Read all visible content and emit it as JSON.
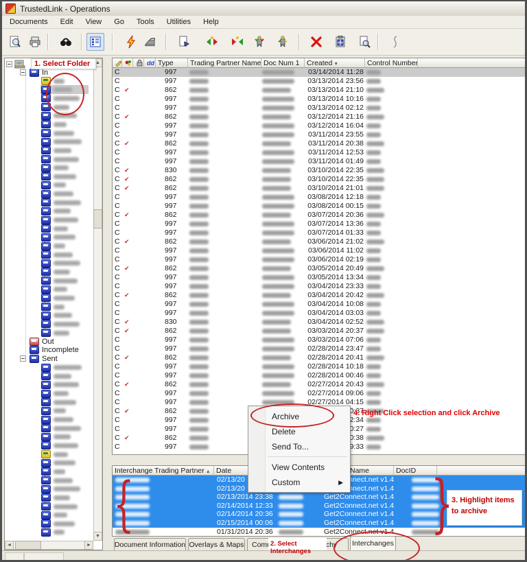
{
  "window": {
    "title": "TrustedLink - Operations"
  },
  "menu_bar": {
    "items": [
      "Documents",
      "Edit",
      "View",
      "Go",
      "Tools",
      "Utilities",
      "Help"
    ]
  },
  "toolbar": {
    "buttons": [
      {
        "name": "print-preview"
      },
      {
        "name": "print"
      },
      {
        "sep": true
      },
      {
        "name": "find"
      },
      {
        "sep": true
      },
      {
        "name": "view-details",
        "pressed": true
      },
      {
        "sep": true
      },
      {
        "name": "process-lightning"
      },
      {
        "name": "send-iron"
      },
      {
        "sep": true
      },
      {
        "name": "export-document"
      },
      {
        "name": "translate-inbound"
      },
      {
        "name": "translate-outbound"
      },
      {
        "name": "task-runner-1"
      },
      {
        "name": "task-runner-2"
      },
      {
        "sep": true
      },
      {
        "name": "delete"
      },
      {
        "name": "properties-clipboard"
      },
      {
        "name": "view-document"
      },
      {
        "sep": true
      },
      {
        "name": "script-squiggle"
      }
    ]
  },
  "folder_tree": {
    "nodes": [
      {
        "label": "In",
        "expanded": true,
        "blurred_children": 30,
        "open_folder_index": 0,
        "selected_index": 1
      },
      {
        "label": "Out",
        "icon": "red"
      },
      {
        "label": "Incomplete"
      },
      {
        "label": "Sent",
        "expanded": true,
        "blurred_children": 20,
        "open_folder_index": 10
      }
    ]
  },
  "doc_table": {
    "icon_headers": [
      "edit-pencil",
      "attachment",
      "lock",
      "duplicate"
    ],
    "headers": [
      "Type",
      "Trading Partner Name",
      "Doc Num 1",
      "Created",
      "Control Number"
    ],
    "sort_column": "Created",
    "sort_direction": "desc",
    "rows": [
      {
        "status": "C",
        "ack": false,
        "type": "997",
        "created": "03/14/2014 11:28",
        "selected": true
      },
      {
        "status": "C",
        "ack": false,
        "type": "997",
        "created": "03/13/2014 23:56"
      },
      {
        "status": "C",
        "ack": true,
        "type": "862",
        "created": "03/13/2014 21:10"
      },
      {
        "status": "C",
        "ack": false,
        "type": "997",
        "created": "03/13/2014 10:16"
      },
      {
        "status": "C",
        "ack": false,
        "type": "997",
        "created": "03/13/2014 02:12"
      },
      {
        "status": "C",
        "ack": true,
        "type": "862",
        "created": "03/12/2014 21:16"
      },
      {
        "status": "C",
        "ack": false,
        "type": "997",
        "created": "03/12/2014 16:04"
      },
      {
        "status": "C",
        "ack": false,
        "type": "997",
        "created": "03/11/2014 23:55"
      },
      {
        "status": "C",
        "ack": true,
        "type": "862",
        "created": "03/11/2014 20:38"
      },
      {
        "status": "C",
        "ack": false,
        "type": "997",
        "created": "03/11/2014 12:53"
      },
      {
        "status": "C",
        "ack": false,
        "type": "997",
        "created": "03/11/2014 01:49"
      },
      {
        "status": "C",
        "ack": true,
        "type": "830",
        "created": "03/10/2014 22:35"
      },
      {
        "status": "C",
        "ack": true,
        "type": "862",
        "created": "03/10/2014 22:35"
      },
      {
        "status": "C",
        "ack": true,
        "type": "862",
        "created": "03/10/2014 21:01"
      },
      {
        "status": "C",
        "ack": false,
        "type": "997",
        "created": "03/08/2014 12:18"
      },
      {
        "status": "C",
        "ack": false,
        "type": "997",
        "created": "03/08/2014 00:15"
      },
      {
        "status": "C",
        "ack": true,
        "type": "862",
        "created": "03/07/2014 20:36"
      },
      {
        "status": "C",
        "ack": false,
        "type": "997",
        "created": "03/07/2014 13:36"
      },
      {
        "status": "C",
        "ack": false,
        "type": "997",
        "created": "03/07/2014 01:33"
      },
      {
        "status": "C",
        "ack": true,
        "type": "862",
        "created": "03/06/2014 21:02"
      },
      {
        "status": "C",
        "ack": false,
        "type": "997",
        "created": "03/06/2014 11:02"
      },
      {
        "status": "C",
        "ack": false,
        "type": "997",
        "created": "03/06/2014 02:19"
      },
      {
        "status": "C",
        "ack": true,
        "type": "862",
        "created": "03/05/2014 20:49"
      },
      {
        "status": "C",
        "ack": false,
        "type": "997",
        "created": "03/05/2014 13:34"
      },
      {
        "status": "C",
        "ack": false,
        "type": "997",
        "created": "03/04/2014 23:33"
      },
      {
        "status": "C",
        "ack": true,
        "type": "862",
        "created": "03/04/2014 20:42"
      },
      {
        "status": "C",
        "ack": false,
        "type": "997",
        "created": "03/04/2014 10:08"
      },
      {
        "status": "C",
        "ack": false,
        "type": "997",
        "created": "03/04/2014 03:03"
      },
      {
        "status": "C",
        "ack": true,
        "type": "830",
        "created": "03/04/2014 02:52"
      },
      {
        "status": "C",
        "ack": true,
        "type": "862",
        "created": "03/03/2014 20:37"
      },
      {
        "status": "C",
        "ack": false,
        "type": "997",
        "created": "03/03/2014 07:06"
      },
      {
        "status": "C",
        "ack": false,
        "type": "997",
        "created": "02/28/2014 23:47"
      },
      {
        "status": "C",
        "ack": true,
        "type": "862",
        "created": "02/28/2014 20:41"
      },
      {
        "status": "C",
        "ack": false,
        "type": "997",
        "created": "02/28/2014 10:18"
      },
      {
        "status": "C",
        "ack": false,
        "type": "997",
        "created": "02/28/2014 00:46"
      },
      {
        "status": "C",
        "ack": true,
        "type": "862",
        "created": "02/27/2014 20:43"
      },
      {
        "status": "C",
        "ack": false,
        "type": "997",
        "created": "02/27/2014 09:06"
      },
      {
        "status": "C",
        "ack": false,
        "type": "997",
        "created": "02/27/2014 04:15"
      },
      {
        "status": "C",
        "ack": true,
        "type": "862",
        "created": "0:37"
      },
      {
        "status": "C",
        "ack": false,
        "type": "997",
        "created": "2:34"
      },
      {
        "status": "C",
        "ack": false,
        "type": "997",
        "created": "0:27"
      },
      {
        "status": "C",
        "ack": true,
        "type": "862",
        "created": "0:38"
      },
      {
        "status": "C",
        "ack": false,
        "type": "997",
        "created": "9:33"
      }
    ]
  },
  "context_menu": {
    "items": [
      {
        "label": "Archive",
        "circled": true
      },
      {
        "label": "Delete"
      },
      {
        "label": "Send To..."
      },
      {
        "separator": true
      },
      {
        "label": "View Contents"
      },
      {
        "label": "Custom",
        "submenu": true
      }
    ]
  },
  "interchange_table": {
    "headers": [
      "Interchange Trading Partner",
      "Date",
      "",
      "Name",
      "DocID"
    ],
    "sort_column": "Interchange Trading Partner",
    "sort_direction": "asc",
    "rows": [
      {
        "date": "02/13/20",
        "name": "Get2Connect.net v1.4",
        "selected": true
      },
      {
        "date": "02/13/20",
        "name": "Get2Connect.net v1.4",
        "selected": true
      },
      {
        "date": "02/13/2014 23:38",
        "name": "Get2Connect.net v1.4",
        "selected": true
      },
      {
        "date": "02/14/2014 12:33",
        "name": "Get2Connect.net v1.4",
        "selected": true
      },
      {
        "date": "02/14/2014 20:36",
        "name": "Get2Connect.net v1.4",
        "selected": true
      },
      {
        "date": "02/15/2014 00:06",
        "name": "Get2Connect.net v1.4",
        "selected": true
      },
      {
        "date": "01/31/2014 20:36",
        "name": "Get2Connect.net v1.4",
        "selected": false
      }
    ]
  },
  "tabs": {
    "items": [
      "Document Information",
      "Overlays & Maps",
      "Comm",
      "chy",
      "Interchanges"
    ],
    "active": "Interchanges"
  },
  "annotations": {
    "step1": "1. Select Folder",
    "step2": "2. Select Interchanges",
    "step3": "3. Highlight items to archive",
    "step4": "4. Right Click selection and click Archive"
  },
  "colors": {
    "selection_blue": "#2e8ceb",
    "annotation_red": "#cc0000",
    "check_red": "#dd2222"
  }
}
